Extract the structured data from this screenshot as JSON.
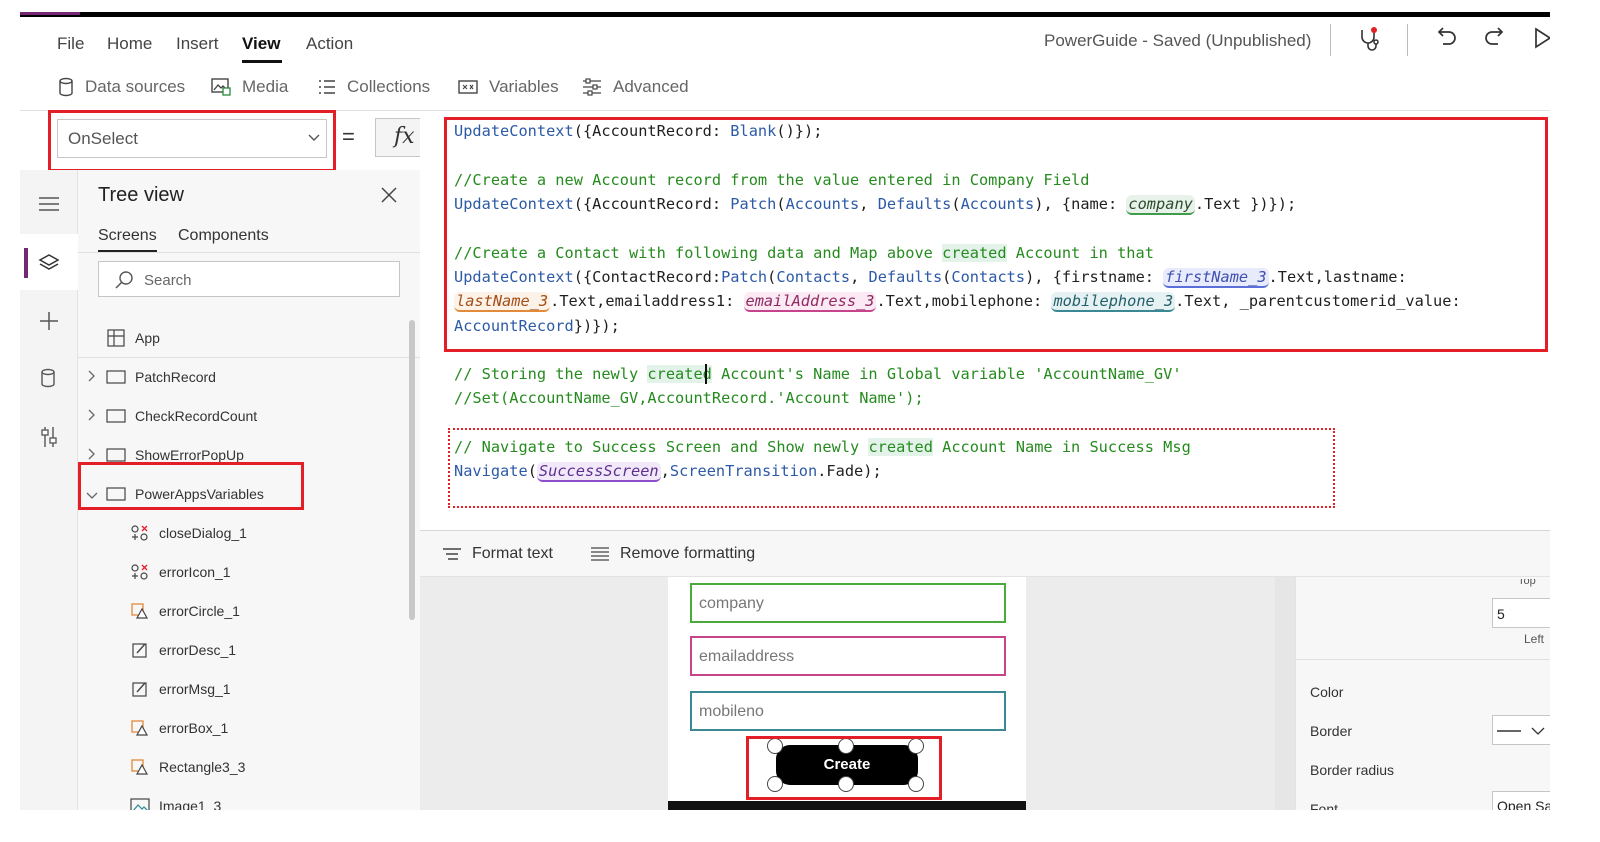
{
  "menu": {
    "file": "File",
    "home": "Home",
    "insert": "Insert",
    "view": "View",
    "action": "Action"
  },
  "app_status": "PowerGuide - Saved (Unpublished)",
  "toolbar": {
    "data_sources": "Data sources",
    "media": "Media",
    "collections": "Collections",
    "variables": "Variables",
    "advanced": "Advanced"
  },
  "formula_bar": {
    "property": "OnSelect",
    "equals": "=",
    "fx": "fx"
  },
  "tree": {
    "title": "Tree view",
    "tabs": [
      "Screens",
      "Components"
    ],
    "search_placeholder": "Search",
    "app": "App",
    "screens": [
      "PatchRecord",
      "CheckRecordCount",
      "ShowErrorPopUp",
      "PowerAppsVariables"
    ],
    "children": [
      "closeDialog_1",
      "errorIcon_1",
      "errorCircle_1",
      "errorDesc_1",
      "errorMsg_1",
      "errorBox_1",
      "Rectangle3_3",
      "Image1_3"
    ]
  },
  "code": {
    "l1a": "UpdateContext",
    "l1b": "({AccountRecord: ",
    "l1c": "Blank",
    "l1d": "()});",
    "l2": "//Create a new Account record from the value entered in Company Field",
    "l3a": "UpdateContext",
    "l3b": "({AccountRecord: ",
    "l3c": "Patch",
    "l3d": "(",
    "l3e": "Accounts",
    "l3f": ", ",
    "l3g": "Defaults",
    "l3h": "(",
    "l3i": "Accounts",
    "l3j": "), {name: ",
    "l3k": "company",
    "l3l": ".Text })});",
    "l4a": "//Create a Contact with following data and Map above ",
    "l4b": "created",
    "l4c": " Account in that",
    "l5a": "UpdateContext",
    "l5b": "({ContactRecord:",
    "l5c": "Patch",
    "l5d": "(",
    "l5e": "Contacts",
    "l5f": ", ",
    "l5g": "Defaults",
    "l5h": "(",
    "l5i": "Contacts",
    "l5j": "), {firstname: ",
    "l5k": "firstName_3",
    "l5l": ".Text,lastname:",
    "l6a": "lastName_3",
    "l6b": ".Text,emailaddress1: ",
    "l6c": "emailAddress_3",
    "l6d": ".Text,mobilephone: ",
    "l6e": "mobilephone_3",
    "l6f": ".Text, _parentcustomerid_value:",
    "l7a": "AccountRecord",
    "l7b": "})});",
    "l8a": "// Storing the newly ",
    "l8b": "created",
    "l8c": " Account's Name in Global variable 'AccountName_GV'",
    "l9": "//Set(AccountName_GV,AccountRecord.'Account Name');",
    "l10a": "// Navigate to Success Screen and Show newly ",
    "l10b": "created",
    "l10c": " Account Name in Success Msg",
    "l11a": "Navigate",
    "l11b": "(",
    "l11c": "SuccessScreen",
    "l11d": ",",
    "l11e": "ScreenTransition",
    "l11f": ".Fade);"
  },
  "format_bar": {
    "format_text": "Format text",
    "remove_formatting": "Remove formatting"
  },
  "form": {
    "company": "company",
    "email": "emailaddress",
    "mobile": "mobileno",
    "button": "Create"
  },
  "props": {
    "top_label": "Top",
    "top_value": "5",
    "left_label": "Left",
    "color": "Color",
    "border": "Border",
    "border_radius": "Border radius",
    "font": "Font",
    "font_value": "Open Sa"
  },
  "colors": {
    "highlight_red": "#e41e26",
    "keyword_blue": "#2d5aa6",
    "comment_green": "#268b1f"
  }
}
